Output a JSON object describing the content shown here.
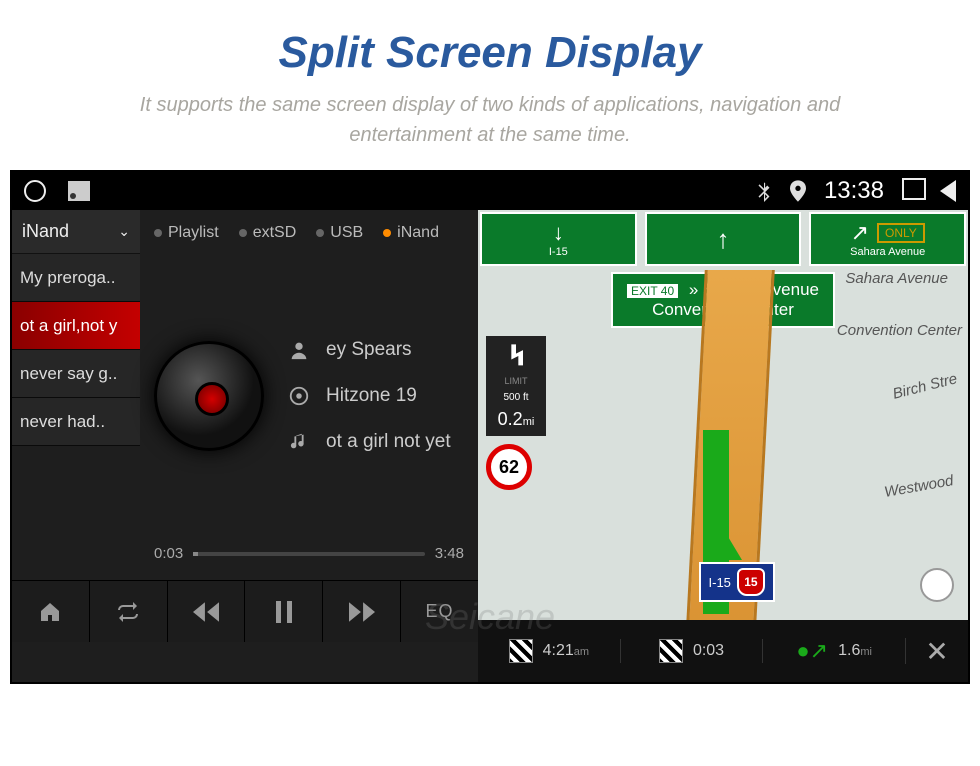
{
  "header": {
    "title": "Split Screen Display",
    "subtitle": "It supports the same screen display of two kinds of applications, navigation and entertainment at the same time."
  },
  "statusbar": {
    "time": "13:38"
  },
  "media": {
    "source_selected": "iNand",
    "source_tabs": [
      "Playlist",
      "extSD",
      "USB",
      "iNand"
    ],
    "active_tab_index": 3,
    "playlist": [
      {
        "label": "My preroga..",
        "active": false
      },
      {
        "label": "ot a girl,not y",
        "active": true
      },
      {
        "label": "never say g..",
        "active": false
      },
      {
        "label": "never had..",
        "active": false
      }
    ],
    "now_playing": {
      "artist": "ey Spears",
      "album": "Hitzone 19",
      "track": "ot a girl not yet"
    },
    "progress": {
      "elapsed": "0:03",
      "total": "3:48"
    },
    "controls": {
      "eq": "EQ"
    }
  },
  "nav": {
    "signs": {
      "freeway": "I-15",
      "street": "Sahara Avenue",
      "only": "ONLY"
    },
    "exit": {
      "tag": "EXIT 40",
      "line1": "» Sahara Avenue",
      "line2": "Convention Center"
    },
    "distance_panel": {
      "limit_label": "LIMIT",
      "limit_footer": "500 ft",
      "dist_value": "0.2",
      "dist_unit": "mi",
      "speed_limit": "62"
    },
    "route_shield": {
      "name": "I-15",
      "badge": "15"
    },
    "streets": [
      "Sahara Avenue",
      "Birch Stre",
      "Convention Center",
      "Westwood"
    ],
    "bottom": {
      "eta_value": "4:21",
      "eta_unit": "am",
      "trip_time": "0:03",
      "trip_dist_value": "1.6",
      "trip_dist_unit": "mi"
    }
  },
  "watermark": "Seicane"
}
